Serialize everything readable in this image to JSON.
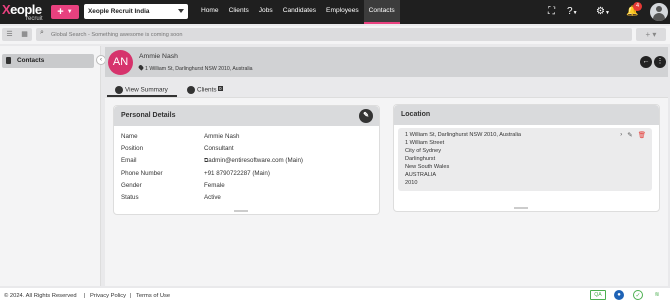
{
  "logo": {
    "mark": "X",
    "name": "eople",
    "sub": "recruit"
  },
  "topbar": {
    "add_label": "+",
    "app_select": "Xeople Recruit India",
    "nav": [
      "Home",
      "Clients",
      "Jobs",
      "Candidates",
      "Employees",
      "Contacts"
    ],
    "active_nav": "Contacts",
    "notification_count": "4"
  },
  "search": {
    "placeholder": "Global Search - Something awesome is coming soon"
  },
  "sidebar": {
    "items": [
      {
        "label": "Contacts",
        "icon": "contact-card-icon"
      }
    ]
  },
  "contact": {
    "initials": "AN",
    "name": "Ammie Nash",
    "address": "1 William St, Darlinghurst NSW 2010, Australia",
    "avatar_color": "#d6336c"
  },
  "tabs": [
    {
      "label": "View Summary",
      "icon": "summary-icon"
    },
    {
      "label": "Clients",
      "icon": "clients-icon",
      "count": "0"
    }
  ],
  "personal": {
    "title": "Personal Details",
    "rows": [
      {
        "label": "Name",
        "value": "Ammie Nash"
      },
      {
        "label": "Position",
        "value": "Consultant"
      },
      {
        "label": "Email",
        "value": "admin@entiresoftware.com (Main)"
      },
      {
        "label": "Phone Number",
        "value": "+91 8790722287 (Main)"
      },
      {
        "label": "Gender",
        "value": "Female"
      },
      {
        "label": "Status",
        "value": "Active"
      }
    ]
  },
  "location": {
    "title": "Location",
    "lines": [
      "1 William St, Darlinghurst NSW 2010, Australia",
      "1 William Street",
      "City of Sydney",
      "Darlinghurst",
      "New South Wales",
      "AUSTRALIA",
      "2010"
    ]
  },
  "footer": {
    "copyright": "© 2024. All Rights Reserved",
    "privacy": "Privacy Policy",
    "sep": "|",
    "terms": "Terms of Use",
    "qa": "QA"
  },
  "colors": {
    "accent": "#e8417f",
    "topbar": "#1f1f1f",
    "status_green": "#4caf50"
  }
}
